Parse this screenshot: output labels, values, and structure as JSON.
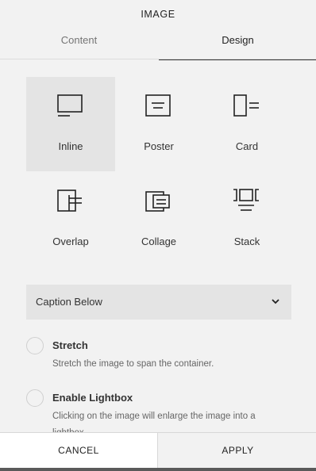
{
  "header": {
    "title": "IMAGE"
  },
  "tabs": [
    {
      "label": "Content",
      "active": false
    },
    {
      "label": "Design",
      "active": true
    }
  ],
  "layouts": [
    {
      "label": "Inline",
      "icon": "inline-layout-icon",
      "selected": true
    },
    {
      "label": "Poster",
      "icon": "poster-layout-icon",
      "selected": false
    },
    {
      "label": "Card",
      "icon": "card-layout-icon",
      "selected": false
    },
    {
      "label": "Overlap",
      "icon": "overlap-layout-icon",
      "selected": false
    },
    {
      "label": "Collage",
      "icon": "collage-layout-icon",
      "selected": false
    },
    {
      "label": "Stack",
      "icon": "stack-layout-icon",
      "selected": false
    }
  ],
  "caption_select": {
    "value": "Caption Below",
    "icon": "chevron-down-icon"
  },
  "options": [
    {
      "title": "Stretch",
      "description": "Stretch the image to span the container.",
      "checked": false
    },
    {
      "title": "Enable Lightbox",
      "description": "Clicking on the image will enlarge the image into a lightbox.",
      "checked": false
    }
  ],
  "footer": {
    "cancel_label": "CANCEL",
    "apply_label": "APPLY"
  },
  "colors": {
    "panel_bg": "#f2f2f2",
    "selected_bg": "#e4e4e4",
    "cancel_bg": "#ffffff"
  }
}
